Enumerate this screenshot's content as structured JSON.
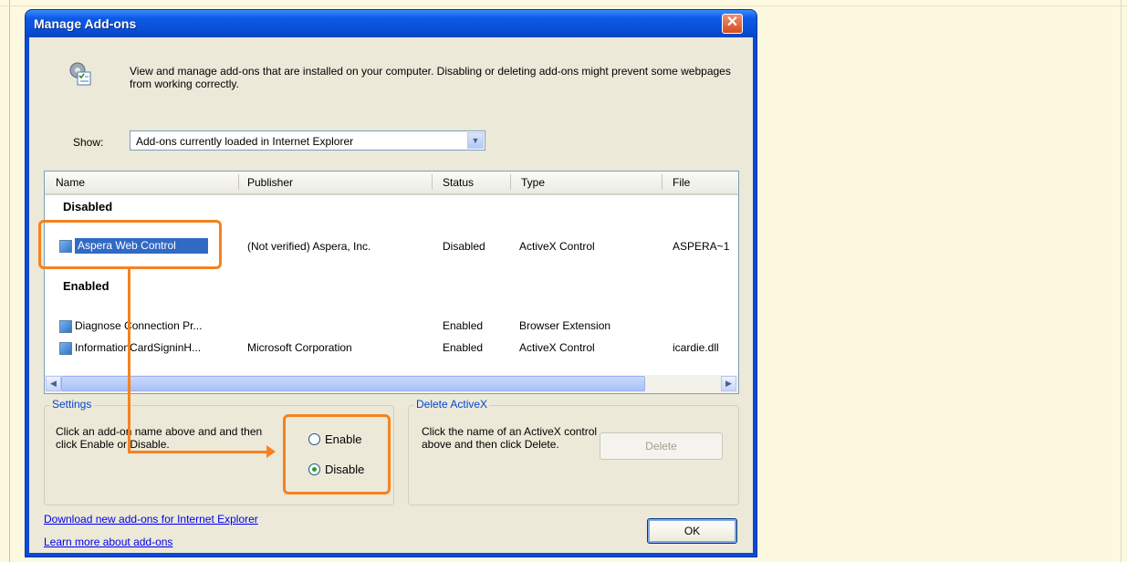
{
  "window": {
    "title": "Manage Add-ons",
    "close_glyph": "✕"
  },
  "header": {
    "description": "View and manage add-ons that are installed on your computer. Disabling or deleting add-ons might prevent some webpages from working correctly.",
    "icon": "add-ons-gear-checklist-icon"
  },
  "show": {
    "label": "Show:",
    "selected": "Add-ons currently loaded in Internet Explorer"
  },
  "table": {
    "columns": [
      "Name",
      "Publisher",
      "Status",
      "Type",
      "File"
    ],
    "groups": [
      {
        "label": "Disabled",
        "rows": [
          {
            "name": "Aspera Web Control",
            "publisher": "(Not verified) Aspera, Inc.",
            "status": "Disabled",
            "type": "ActiveX Control",
            "file": "ASPERA~1"
          }
        ]
      },
      {
        "label": "Enabled",
        "rows": [
          {
            "name": "Diagnose Connection Pr...",
            "publisher": "",
            "status": "Enabled",
            "type": "Browser Extension",
            "file": ""
          },
          {
            "name": "InformationCardSigninH...",
            "publisher": "Microsoft Corporation",
            "status": "Enabled",
            "type": "ActiveX Control",
            "file": "icardie.dll"
          }
        ]
      }
    ]
  },
  "settings": {
    "title": "Settings",
    "text": "Click an add-on name above and and then click Enable or Disable.",
    "options": [
      {
        "label": "Enable",
        "checked": false
      },
      {
        "label": "Disable",
        "checked": true
      }
    ]
  },
  "delete_activex": {
    "title": "Delete ActiveX",
    "text": "Click the name of an ActiveX control above and then click Delete.",
    "button": "Delete"
  },
  "links": {
    "download": "Download new add-ons for Internet Explorer",
    "learn": "Learn more about add-ons"
  },
  "ok_button": "OK",
  "colors": {
    "highlight": "#f58220",
    "selection": "#316ac5",
    "title_bar": "#0a4fd6"
  }
}
